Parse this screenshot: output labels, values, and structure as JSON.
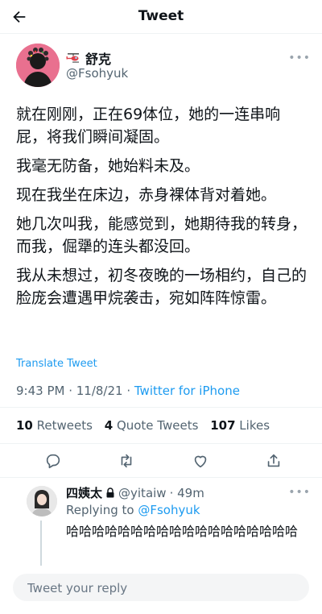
{
  "header": {
    "title": "Tweet"
  },
  "tweet": {
    "author_name": "舒克",
    "author_handle": "@Fsohyuk",
    "body": [
      "就在刚刚，正在69体位，她的一连串响屁，将我们瞬间凝固。",
      "我毫无防备，她始料未及。",
      "现在我坐在床边，赤身裸体背对着她。",
      "她几次叫我，能感觉到，她期待我的转身，而我，倔犟的连头都没回。",
      "我从未想过，初冬夜晚的一场相约，自己的脸庞会遭遇甲烷袭击，宛如阵阵惊雷。"
    ],
    "translate_label": "Translate Tweet",
    "time": "9:43 PM · 11/8/21 · ",
    "source": "Twitter for iPhone",
    "stats": {
      "retweets_count": "10",
      "retweets_label": "Retweets",
      "quotes_count": "4",
      "quotes_label": "Quote Tweets",
      "likes_count": "107",
      "likes_label": "Likes"
    }
  },
  "reply": {
    "name": "四姨太",
    "handle": "@yitaiw",
    "time": "· 49m",
    "replying_label": "Replying to",
    "replying_to": "@Fsohyuk",
    "text": "哈哈哈哈哈哈哈哈哈哈哈哈哈哈哈哈哈哈"
  },
  "composer": {
    "placeholder": "Tweet your reply"
  },
  "icons": {
    "back": "arrow-left-icon",
    "helicopter": "helicopter-icon",
    "more": "more-dots-icon",
    "reply": "reply-icon",
    "retweet": "retweet-icon",
    "like": "heart-icon",
    "share": "share-icon",
    "lock": "lock-icon"
  },
  "colors": {
    "link": "#1d9bf0",
    "muted": "#536471",
    "text": "#0f1419",
    "avatar_bg": "#e9708f"
  }
}
